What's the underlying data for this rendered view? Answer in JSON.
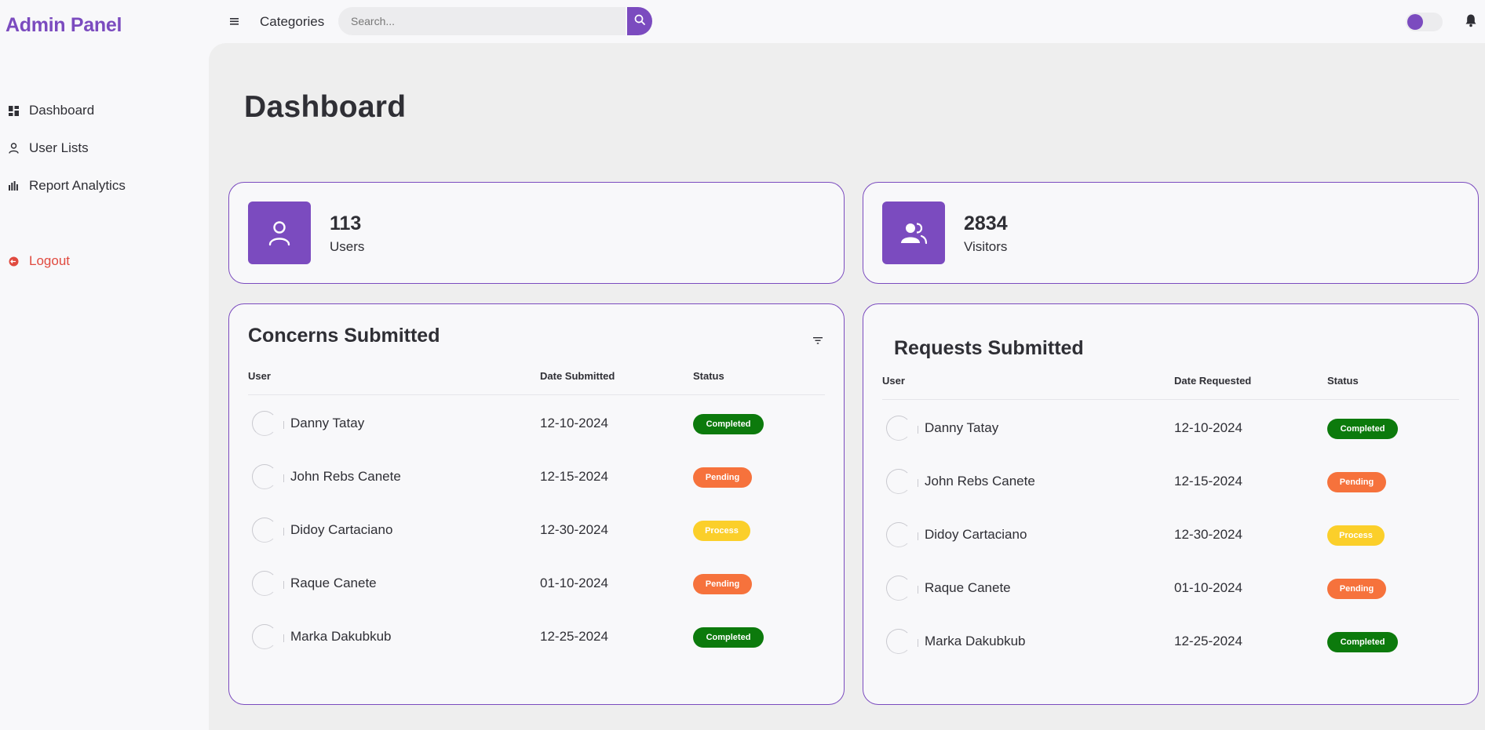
{
  "brand": "Admin Panel",
  "sidebar": {
    "items": [
      {
        "label": "Dashboard",
        "icon": "dashboard-grid-icon"
      },
      {
        "label": "User Lists",
        "icon": "user-icon"
      },
      {
        "label": "Report Analytics",
        "icon": "bar-chart-icon"
      }
    ],
    "logout": {
      "label": "Logout",
      "icon": "logout-icon"
    }
  },
  "topbar": {
    "categories": "Categories",
    "search": {
      "placeholder": "Search...",
      "value": ""
    },
    "theme_toggle": {
      "on": false
    }
  },
  "main": {
    "title": "Dashboard",
    "stats": [
      {
        "value": "113",
        "label": "Users",
        "icon": "user-icon"
      },
      {
        "value": "2834",
        "label": "Visitors",
        "icon": "users-group-icon"
      }
    ],
    "concerns": {
      "title": "Concerns Submitted",
      "columns": [
        "User",
        "Date Submitted",
        "Status"
      ],
      "rows": [
        {
          "user": "Danny Tatay",
          "date": "12-10-2024",
          "status": "Completed"
        },
        {
          "user": "John Rebs Canete",
          "date": "12-15-2024",
          "status": "Pending"
        },
        {
          "user": "Didoy Cartaciano",
          "date": "12-30-2024",
          "status": "Process"
        },
        {
          "user": "Raque Canete",
          "date": "01-10-2024",
          "status": "Pending"
        },
        {
          "user": "Marka Dakubkub",
          "date": "12-25-2024",
          "status": "Completed"
        }
      ]
    },
    "requests": {
      "title": "Requests Submitted",
      "columns": [
        "User",
        "Date Requested",
        "Status"
      ],
      "rows": [
        {
          "user": "Danny Tatay",
          "date": "12-10-2024",
          "status": "Completed"
        },
        {
          "user": "John Rebs Canete",
          "date": "12-15-2024",
          "status": "Pending"
        },
        {
          "user": "Didoy Cartaciano",
          "date": "12-30-2024",
          "status": "Process"
        },
        {
          "user": "Raque Canete",
          "date": "01-10-2024",
          "status": "Pending"
        },
        {
          "user": "Marka Dakubkub",
          "date": "12-25-2024",
          "status": "Completed"
        }
      ]
    }
  },
  "colors": {
    "accent": "#7b4bbf",
    "completed": "#0c7a0c",
    "pending": "#f6723c",
    "process": "#fbcf2a",
    "logout": "#e04a3f"
  }
}
